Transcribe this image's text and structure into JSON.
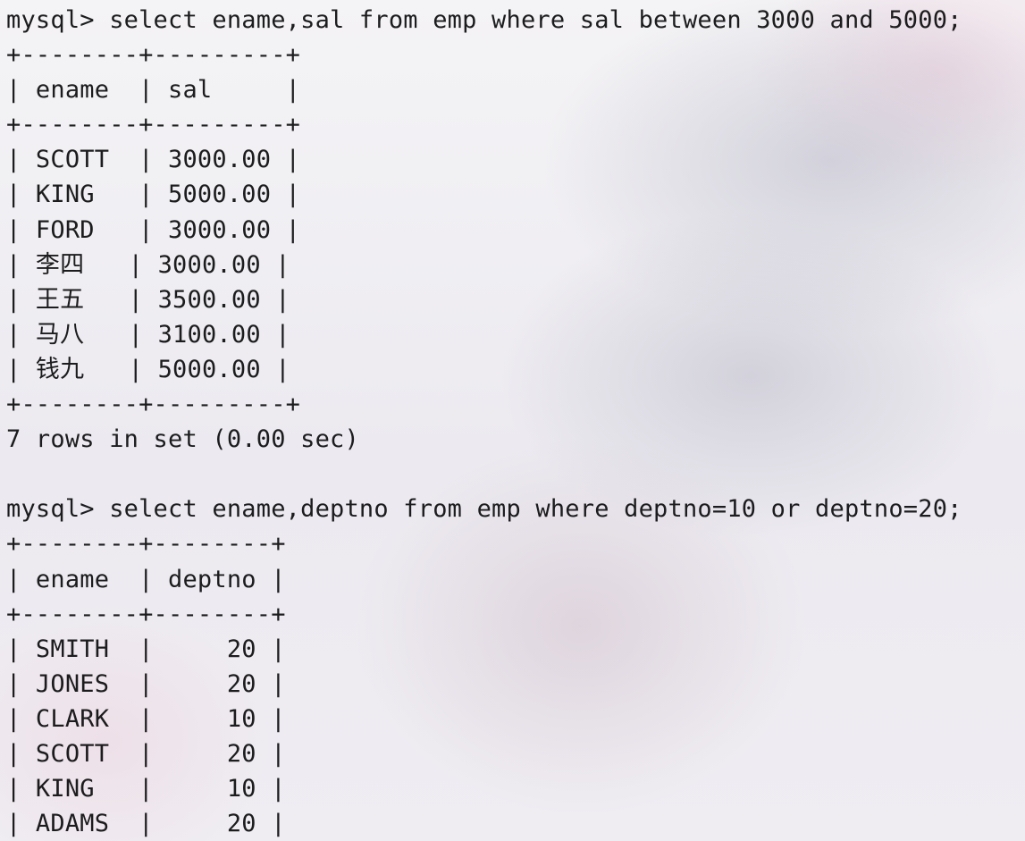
{
  "terminal": {
    "lines": [
      "mysql> select ename,sal from emp where sal between 3000 and 5000;",
      "+--------+---------+",
      "| ename  | sal     |",
      "+--------+---------+",
      "| SCOTT  | 3000.00 |",
      "| KING   | 5000.00 |",
      "| FORD   | 3000.00 |",
      "| 李四   | 3000.00 |",
      "| 王五   | 3500.00 |",
      "| 马八   | 3100.00 |",
      "| 钱九   | 5000.00 |",
      "+--------+---------+",
      "7 rows in set (0.00 sec)",
      "",
      "mysql> select ename,deptno from emp where deptno=10 or deptno=20;",
      "+--------+--------+",
      "| ename  | deptno |",
      "+--------+--------+",
      "| SMITH  |     20 |",
      "| JONES  |     20 |",
      "| CLARK  |     10 |",
      "| SCOTT  |     20 |",
      "| KING   |     10 |",
      "| ADAMS  |     20 |"
    ]
  }
}
